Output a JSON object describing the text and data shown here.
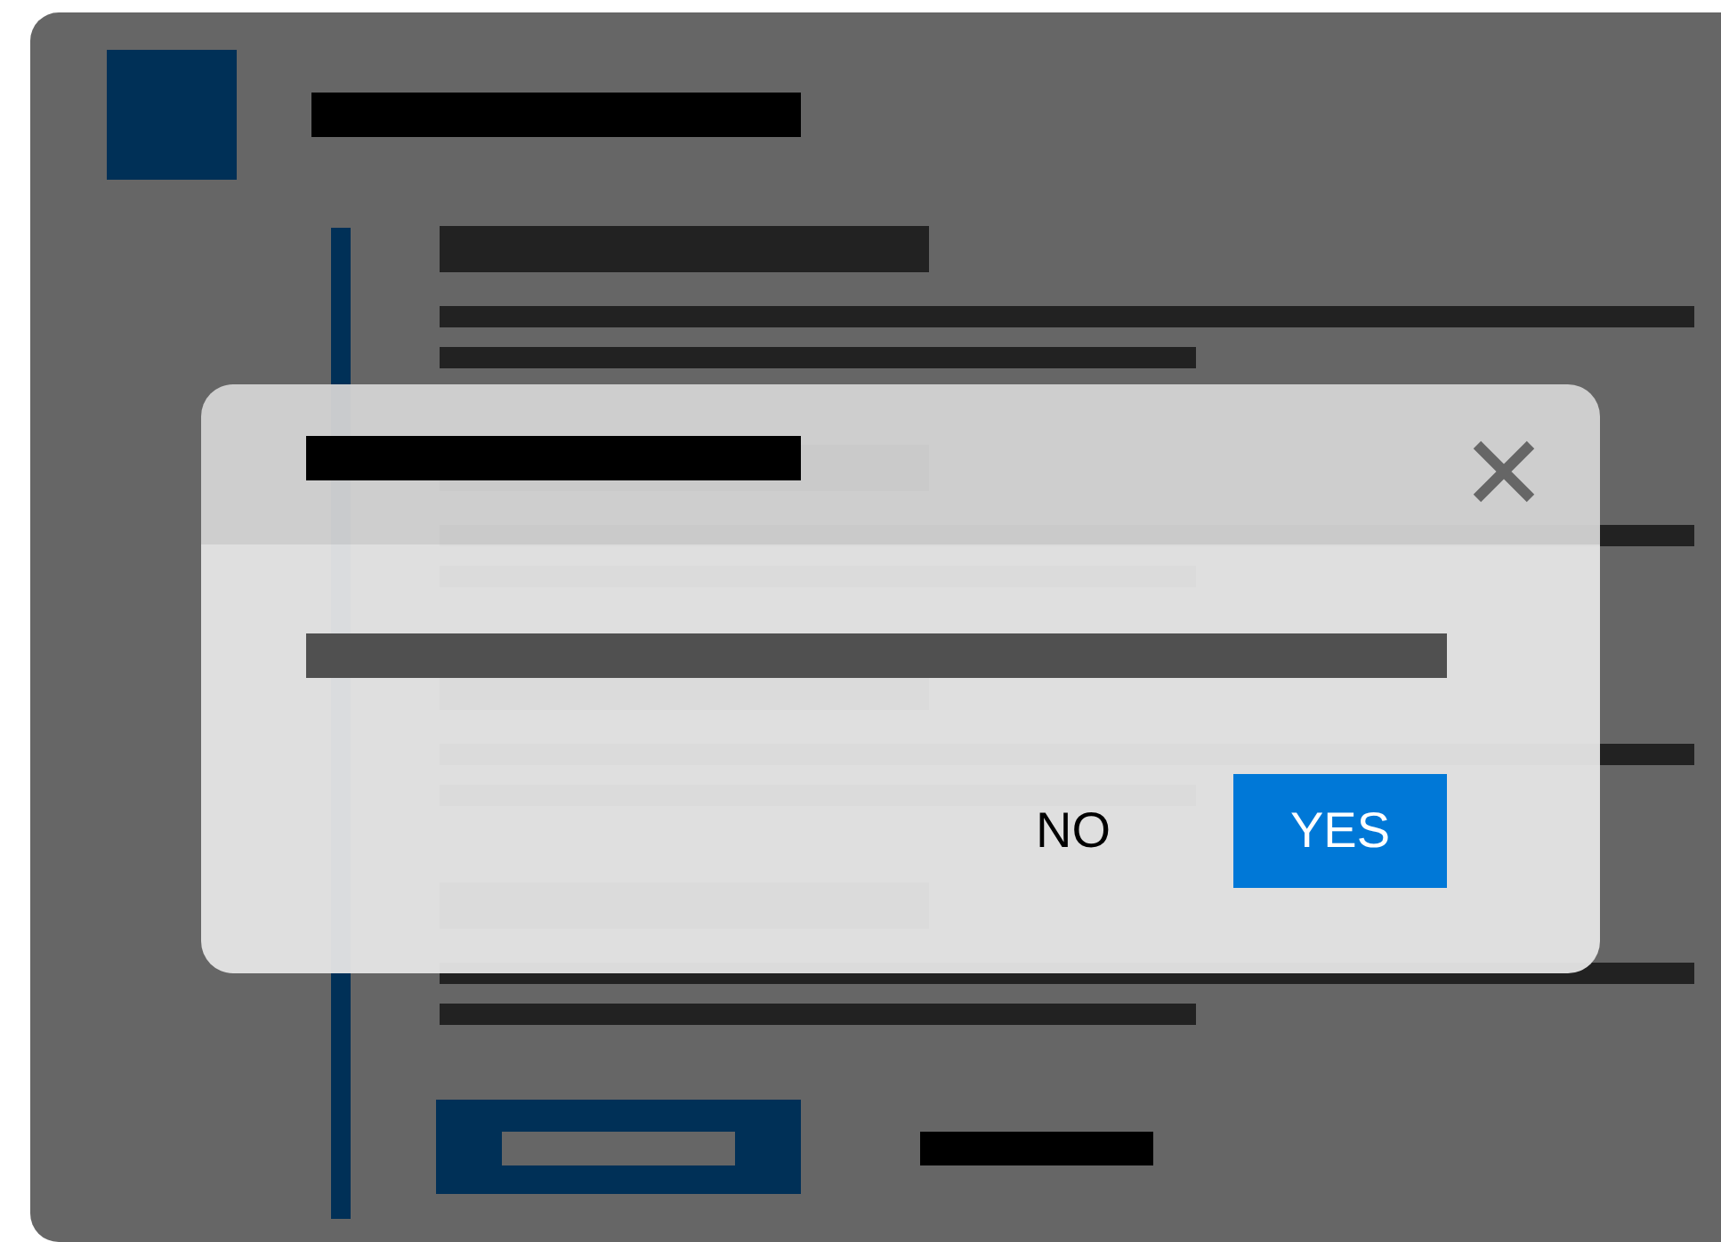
{
  "dialog": {
    "buttons": [
      {
        "label": "NO",
        "kind": "secondary"
      },
      {
        "label": "YES",
        "kind": "primary"
      }
    ]
  }
}
